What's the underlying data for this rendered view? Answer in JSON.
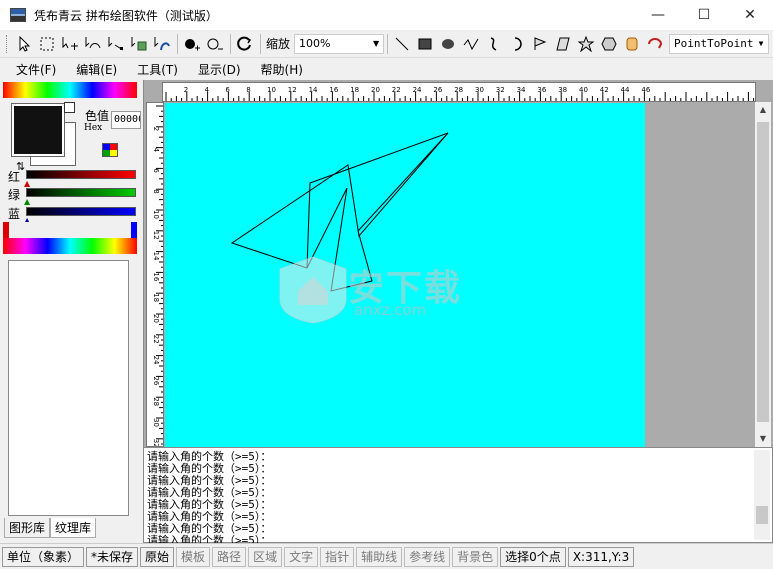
{
  "window": {
    "title": "凭布青云 拼布绘图软件（测试版）",
    "minimize_glyph": "—",
    "maximize_glyph": "☐",
    "close_glyph": "✕"
  },
  "toolbar": {
    "zoom_label": "缩放",
    "zoom_value": "100%",
    "draw_mode_value": "PointToPoint",
    "icons": [
      "select-arrow-icon",
      "rect-select-icon",
      "move-point-icon",
      "curve-select-icon",
      "move-node-icon",
      "transform-icon",
      "node-edit-icon",
      "add-point-icon",
      "remove-point-icon",
      "rotate-icon",
      "line-icon",
      "rectangle-icon",
      "ellipse-icon",
      "polyline-icon",
      "bezier-icon",
      "arc-icon",
      "flag-icon",
      "parallelogram-icon",
      "star-icon",
      "hexagon-icon",
      "rounded-rect-icon",
      "hook-icon"
    ]
  },
  "menu": {
    "items": [
      "文件(F)",
      "编辑(E)",
      "工具(T)",
      "显示(D)",
      "帮助(H)"
    ]
  },
  "color_panel": {
    "color_value_label": "色值",
    "hex_label": "Hex",
    "hex_value": "000000",
    "red_label": "红",
    "green_label": "绿",
    "blue_label": "蓝",
    "foreground_color": "#111111",
    "background_color": "#ffffff"
  },
  "library_tabs": [
    "图形库",
    "纹理库"
  ],
  "rulers": {
    "top_ticks": [
      "2",
      "4",
      "6",
      "8",
      "10",
      "12",
      "14",
      "16",
      "18",
      "20",
      "22",
      "24",
      "26",
      "28",
      "30",
      "32",
      "34",
      "36",
      "38",
      "40",
      "42",
      "44",
      "46"
    ],
    "left_ticks": [
      "2",
      "4",
      "6",
      "8",
      "10",
      "12",
      "14",
      "16",
      "18",
      "20",
      "22",
      "24",
      "26",
      "28",
      "30",
      "32",
      "34"
    ]
  },
  "canvas": {
    "background_color": "#00ffff"
  },
  "console": {
    "lines": [
      "请输入角的个数（>=5）：",
      "请输入角的个数（>=5）：",
      "请输入角的个数（>=5）：",
      "请输入角的个数（>=5）：",
      "请输入角的个数（>=5）：",
      "请输入角的个数（>=5）：",
      "请输入角的个数（>=5）：",
      "请输入角的个数（>=5）："
    ]
  },
  "watermark": {
    "text": "安下载",
    "subtext": "anxz.com"
  },
  "status": {
    "unit": "单位（象素）",
    "save_state": "*未保存",
    "modes": [
      "原始",
      "模板",
      "路径",
      "区域",
      "文字",
      "指针",
      "辅助线",
      "参考线",
      "背景色"
    ],
    "selection": "选择0个点",
    "coords": "X:311,Y:3"
  }
}
